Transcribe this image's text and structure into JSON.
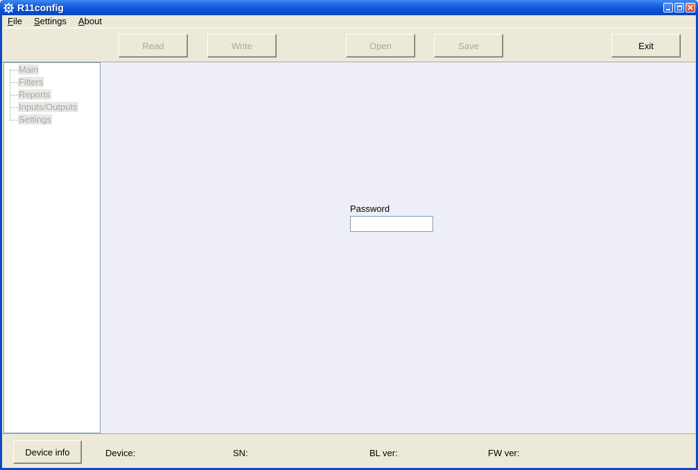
{
  "window": {
    "title": "R11config",
    "icon": "gear-icon"
  },
  "menu": {
    "file_acc": "F",
    "file_rest": "ile",
    "settings_acc": "S",
    "settings_rest": "ettings",
    "about_acc": "A",
    "about_rest": "bout"
  },
  "toolbar": {
    "read": "Read",
    "write": "Write",
    "open": "Open",
    "save": "Save",
    "exit": "Exit"
  },
  "tree": {
    "items": [
      "Main",
      "Filters",
      "Reports",
      "Inputs/Outputs",
      "Settings"
    ]
  },
  "login": {
    "password_label": "Password",
    "password_value": ""
  },
  "status": {
    "device_info_button": "Device info",
    "device_label": "Device:",
    "sn_label": "SN:",
    "bl_label": "BL ver:",
    "fw_label": "FW ver:"
  }
}
